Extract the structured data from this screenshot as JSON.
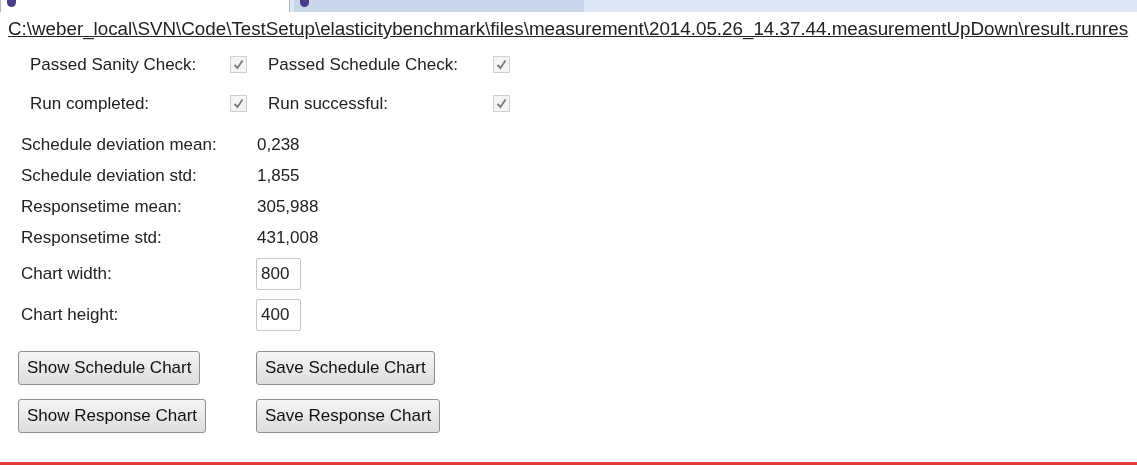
{
  "tabs": [
    {
      "selected": true
    },
    {
      "selected": false
    }
  ],
  "path": "C:\\weber_local\\SVN\\Code\\TestSetup\\elasticitybenchmark\\files\\measurement\\2014.05.26_14.37.44.measurementUpDown\\result.runres",
  "checks": [
    {
      "label": "Passed Sanity Check:",
      "checked": true,
      "disabled": true
    },
    {
      "label": "Passed Schedule Check:",
      "checked": true,
      "disabled": true
    },
    {
      "label": "Run completed:",
      "checked": true,
      "disabled": true
    },
    {
      "label": "Run successful:",
      "checked": true,
      "disabled": true
    }
  ],
  "stats": [
    {
      "label": "Schedule deviation mean:",
      "value": "0,238"
    },
    {
      "label": "Schedule deviation std:",
      "value": "1,855"
    },
    {
      "label": "Responsetime mean:",
      "value": "305,988"
    },
    {
      "label": "Responsetime std:",
      "value": "431,008"
    }
  ],
  "fields": [
    {
      "label": "Chart width:",
      "value": "800"
    },
    {
      "label": "Chart height:",
      "value": "400"
    }
  ],
  "buttons": [
    [
      "Show Schedule Chart",
      "Save Schedule Chart"
    ],
    [
      "Show Response Chart",
      "Save Response Chart"
    ]
  ]
}
